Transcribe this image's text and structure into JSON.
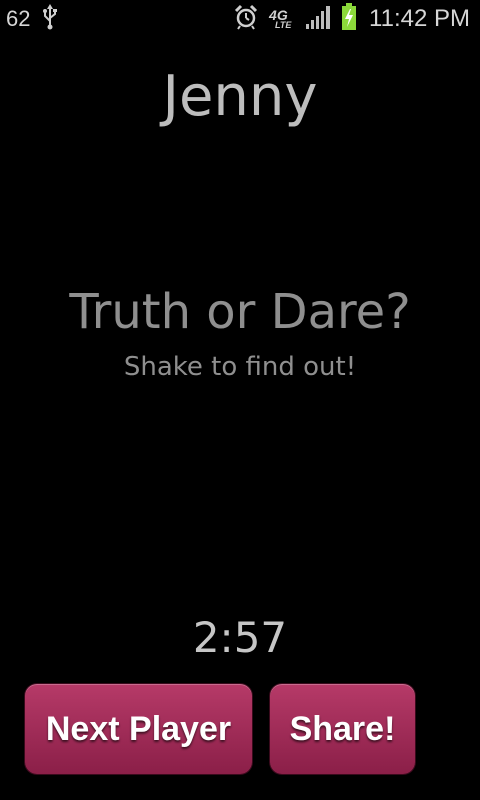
{
  "status_bar": {
    "notification_number": "62",
    "usb_icon": "usb-icon",
    "alarm_icon": "alarm-icon",
    "network_label": "4G",
    "network_sublabel": "LTE",
    "signal_icon": "signal-icon",
    "battery_icon": "battery-charging-icon",
    "clock": "11:42 PM"
  },
  "game": {
    "player_name": "Jenny",
    "question": "Truth or Dare?",
    "instruction": "Shake to find out!",
    "timer": "2:57"
  },
  "buttons": {
    "next_player_label": "Next Player",
    "share_label": "Share!"
  },
  "colors": {
    "background": "#000000",
    "button_gradient_top": "#b63a68",
    "button_gradient_bottom": "#8b1f48",
    "battery_green": "#8bd83a"
  }
}
